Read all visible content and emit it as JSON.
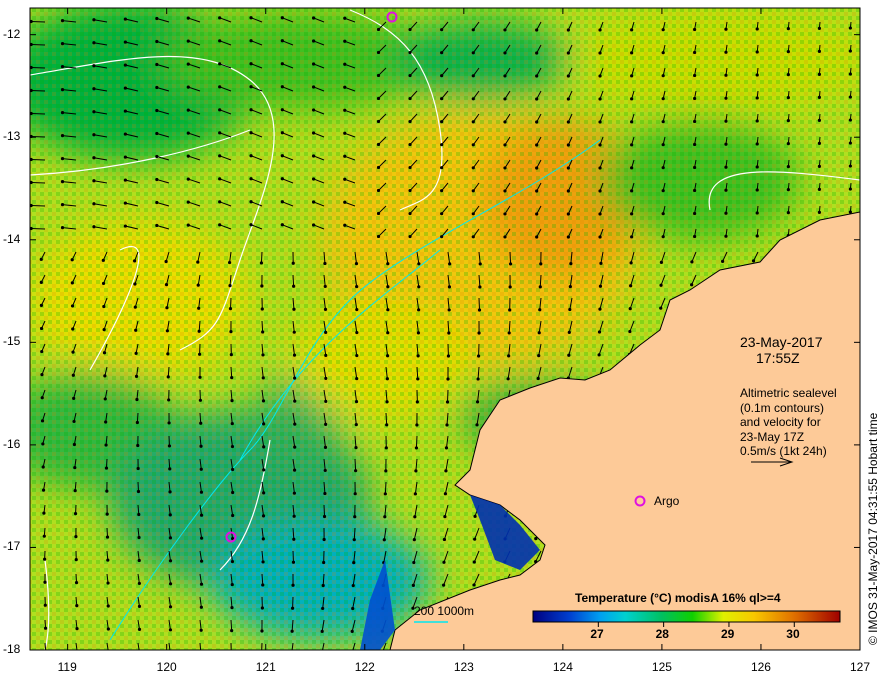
{
  "map": {
    "lon_range": [
      118.62,
      127
    ],
    "lat_range": [
      -18,
      -11.74
    ],
    "lon_ticks": [
      "119",
      "120",
      "121",
      "122",
      "123",
      "124",
      "125",
      "126",
      "127"
    ],
    "lat_ticks": [
      "-12",
      "-13",
      "-14",
      "-15",
      "-16",
      "-17",
      "-18"
    ],
    "land_color": "#fdca98"
  },
  "annotation": {
    "date": "23-May-2017",
    "time": "17:55Z",
    "lines": [
      "Altimetric sealevel",
      "(0.1m contours)",
      "and velocity for",
      "23-May 17Z",
      "0.5m/s (1kt 24h)"
    ]
  },
  "argo": {
    "label": "Argo",
    "color": "#e010e0"
  },
  "depth_legend": {
    "label": "200  1000m",
    "color": "#00e8f0"
  },
  "colorbar": {
    "title": "Temperature (°C) modisA 16% ql>=4",
    "range": [
      26.0,
      30.7
    ],
    "ticks": [
      "27",
      "28",
      "29",
      "30"
    ]
  },
  "credit": "© IMOS 31-May-2017 04:31:55 Hobart time"
}
